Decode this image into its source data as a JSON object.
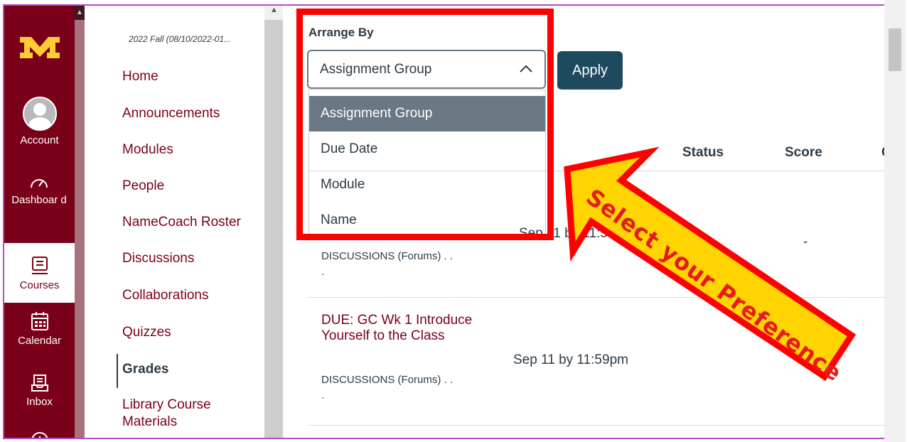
{
  "global_nav": {
    "account_label": "Account",
    "dashboard_label": "Dashboar d",
    "courses_label": "Courses",
    "calendar_label": "Calendar",
    "inbox_label": "Inbox"
  },
  "course_nav": {
    "term": "2022 Fall (08/10/2022-01...",
    "items": [
      "Home",
      "Announcements",
      "Modules",
      "People",
      "NameCoach Roster",
      "Discussions",
      "Collaborations",
      "Quizzes",
      "Grades",
      "Library Course Materials"
    ],
    "active": "Grades"
  },
  "main": {
    "arrange_label": "Arrange By",
    "select_value": "Assignment Group",
    "apply_label": "Apply",
    "options": [
      "Assignment Group",
      "Due Date",
      "Module",
      "Name"
    ],
    "columns": {
      "status": "Status",
      "score": "Score"
    },
    "row1": {
      "date": "Sep 11 by 11:5",
      "subtitle_1": "DISCUSSIONS (Forums) . .",
      "subtitle_2": ".",
      "score": "-"
    },
    "row2": {
      "title": "DUE: GC Wk 1 Introduce Yourself to the Class",
      "subtitle_1": "DISCUSSIONS (Forums) . .",
      "subtitle_2": ".",
      "date": "Sep 11 by 11:59pm"
    }
  },
  "annotation": {
    "text": "Select your Preference"
  },
  "colors": {
    "brand": "#7a0019",
    "apply": "#1d4a5e",
    "highlight": "#6a7883",
    "annotation_red": "#ff0000",
    "annotation_yellow": "#ffd400"
  }
}
